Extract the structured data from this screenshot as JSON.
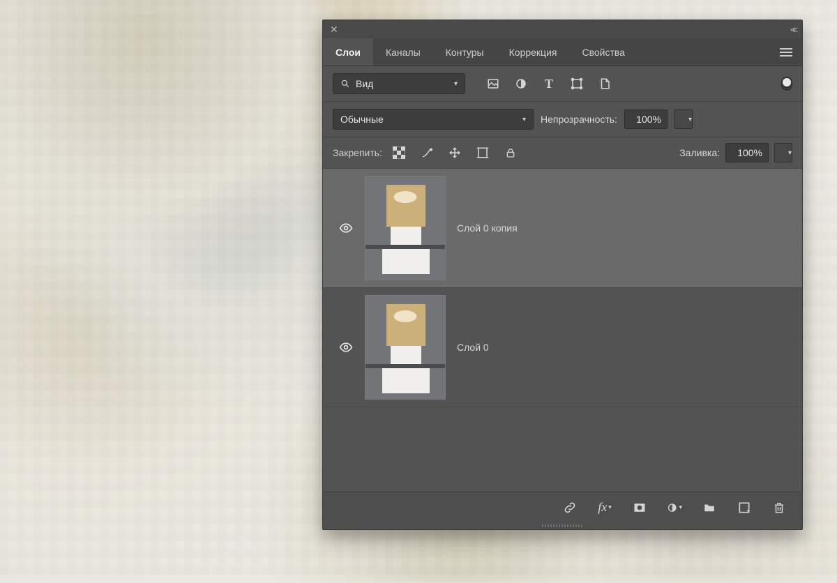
{
  "tabs": {
    "items": [
      {
        "label": "Слои",
        "active": true
      },
      {
        "label": "Каналы",
        "active": false
      },
      {
        "label": "Контуры",
        "active": false
      },
      {
        "label": "Коррекция",
        "active": false
      },
      {
        "label": "Свойства",
        "active": false
      }
    ]
  },
  "search": {
    "label": "Вид"
  },
  "filterIcons": {
    "image": "image-filter-icon",
    "adjust": "adjustment-filter-icon",
    "type": "type-filter-icon",
    "shape": "shape-filter-icon",
    "smart": "smartobject-filter-icon"
  },
  "blend": {
    "mode": "Обычные"
  },
  "opacity": {
    "label": "Непрозрачность:",
    "value": "100%"
  },
  "lock": {
    "label": "Закрепить:"
  },
  "fill": {
    "label": "Заливка:",
    "value": "100%"
  },
  "layers": [
    {
      "name": "Слой 0 копия",
      "visible": true,
      "selected": true,
      "smart": true
    },
    {
      "name": "Слой 0",
      "visible": true,
      "selected": false,
      "smart": false
    }
  ],
  "bottomIcons": {
    "link": "link-layers-icon",
    "fx": "layer-fx-icon",
    "mask": "layer-mask-icon",
    "adjLayer": "adjustment-layer-icon",
    "group": "group-icon",
    "newLayer": "new-layer-icon",
    "trash": "trash-icon"
  }
}
